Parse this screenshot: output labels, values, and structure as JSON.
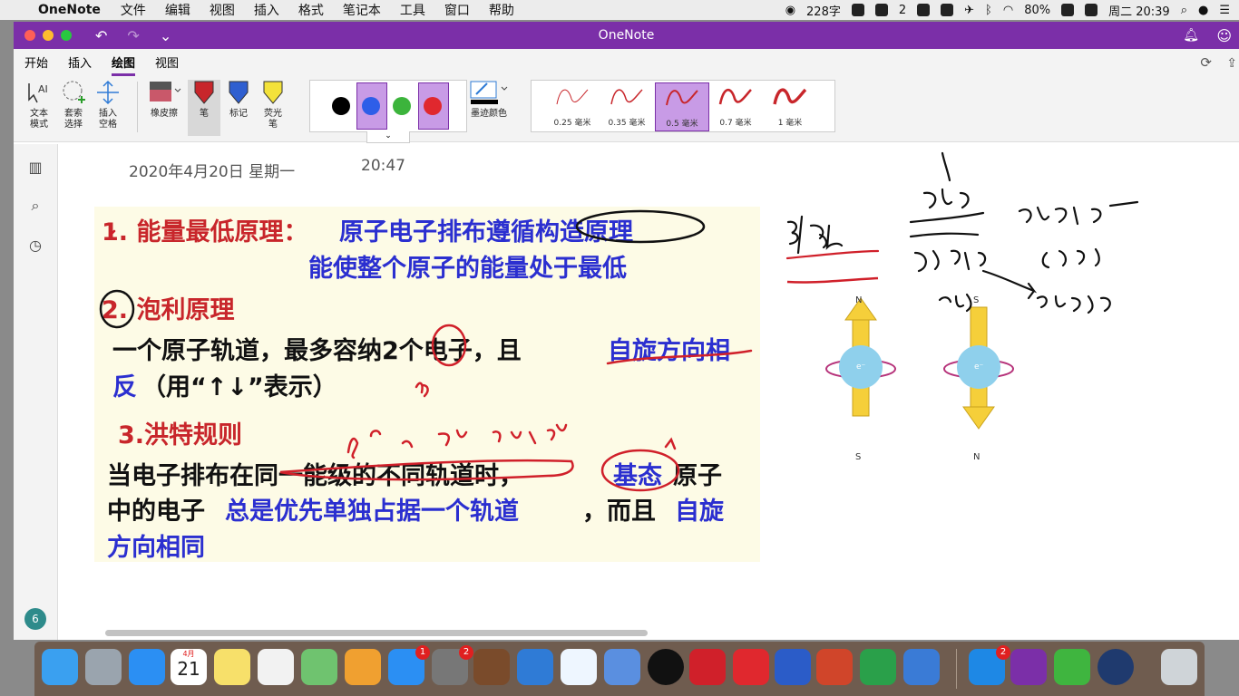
{
  "menubar": {
    "app_name": "OneNote",
    "items": [
      "文件",
      "编辑",
      "视图",
      "插入",
      "格式",
      "笔记本",
      "工具",
      "窗口",
      "帮助"
    ],
    "word_count": "228字",
    "battery": "80%",
    "clock": "周二 20:39",
    "badge_count": "2"
  },
  "window": {
    "title": "OneNote",
    "tabs": [
      "开始",
      "插入",
      "绘图",
      "视图"
    ],
    "active_tab": "绘图"
  },
  "ribbon": {
    "text_mode": "文本\n模式",
    "lasso": "套索\n选择",
    "insert_space": "插入\n空格",
    "eraser": "橡皮擦",
    "pen": "笔",
    "marker": "标记",
    "highlighter": "荧光\n笔",
    "ink_color": "墨迹颜色",
    "colors": [
      "#000000",
      "#2e5ee8",
      "#3cb43c",
      "#e0282e"
    ],
    "thicknesses": [
      "0.25 毫米",
      "0.35 毫米",
      "0.5 毫米",
      "0.7 毫米",
      "1 毫米"
    ],
    "selected_thickness": "0.5 毫米"
  },
  "sidebar": {
    "page_count": "6"
  },
  "page": {
    "date": "2020年4月20日 星期一",
    "time": "20:47",
    "slide": {
      "line1_red": "1. 能量最低原理：",
      "line1_blue": "原子电子排布遵循构造原理",
      "line2_blue": "能使整个原子的能量处于最低",
      "line3_red": "2. 泡利原理",
      "line4_black": "一个原子轨道，最多容纳2个电子，且",
      "line4_blue": "自旋方向相",
      "line5_blue": "反",
      "line5_black": "（用“↑↓”表示）",
      "line6_red": "3.洪特规则",
      "line7_black_a": "当电子排布在同一能级的不同轨道时，",
      "line7_blue": "基态",
      "line7_black_b": "原子",
      "line8_black_a": "中的电子",
      "line8_blue": "总是优先单独占据一个轨道",
      "line8_black_b": "，而且",
      "line8_blue_b": "自旋",
      "line9_blue": "方向相同"
    },
    "spin_labels": {
      "top_left": "N",
      "bottom_left": "S",
      "top_right": "S",
      "bottom_right": "N",
      "electron": "e⁻"
    }
  },
  "dock": {
    "calendar_day": "21",
    "calendar_month": "4月",
    "badges": {
      "appstore": "1",
      "prefs": "2",
      "mail": "2"
    }
  }
}
